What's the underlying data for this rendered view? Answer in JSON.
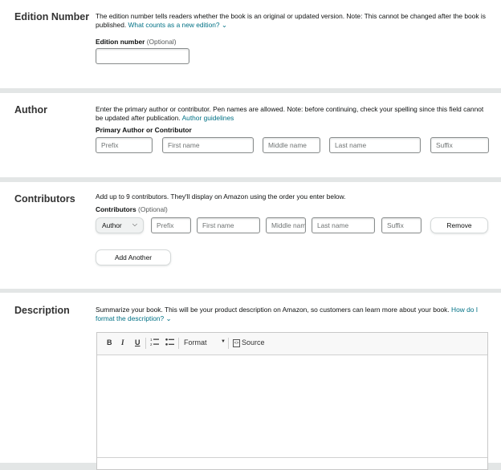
{
  "edition": {
    "title": "Edition Number",
    "desc": "The edition number tells readers whether the book is an original or updated version. Note: This cannot be changed after the book is published.",
    "link": "What counts as a new edition?",
    "field_label": "Edition number",
    "optional": "(Optional)"
  },
  "author": {
    "title": "Author",
    "desc": "Enter the primary author or contributor. Pen names are allowed. Note: before continuing, check your spelling since this field cannot be updated after publication.",
    "link": "Author guidelines",
    "field_label": "Primary Author or Contributor",
    "placeholders": [
      "Prefix",
      "First name",
      "Middle name",
      "Last name",
      "Suffix"
    ]
  },
  "contributors": {
    "title": "Contributors",
    "desc": "Add up to 9 contributors. They'll display on Amazon using the order you enter below.",
    "field_label": "Contributors",
    "optional": "(Optional)",
    "role": "Author",
    "placeholders": [
      "Prefix",
      "First name",
      "Middle name",
      "Last name",
      "Suffix"
    ],
    "remove_label": "Remove",
    "add_label": "Add Another"
  },
  "description": {
    "title": "Description",
    "desc": "Summarize your book. This will be your product description on Amazon, so customers can learn more about your book.",
    "link": "How do I format the description?",
    "toolbar": {
      "bold": "B",
      "italic": "I",
      "underline": "U",
      "format": "Format",
      "source": "Source"
    }
  },
  "colors": {
    "link": "#007185",
    "page_bg": "#e3e6e6"
  }
}
